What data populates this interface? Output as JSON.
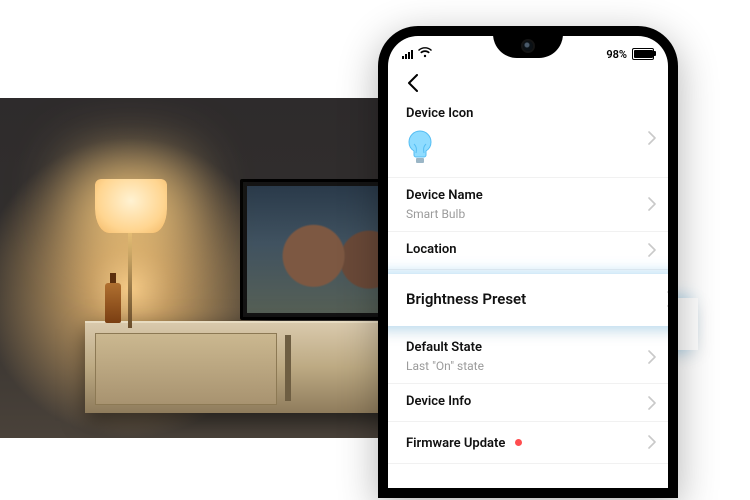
{
  "status_bar": {
    "battery_text": "98%"
  },
  "settings": {
    "device_icon_label": "Device Icon",
    "device_name_label": "Device Name",
    "device_name_value": "Smart Bulb",
    "location_label": "Location",
    "brightness_preset_label": "Brightness Preset",
    "default_state_label": "Default State",
    "default_state_value": "Last \"On\" state",
    "device_info_label": "Device Info",
    "firmware_update_label": "Firmware Update"
  },
  "colors": {
    "highlight_glow": "#9fdcff",
    "badge": "#ff4d4f",
    "bulb": "#7fd4ff"
  }
}
